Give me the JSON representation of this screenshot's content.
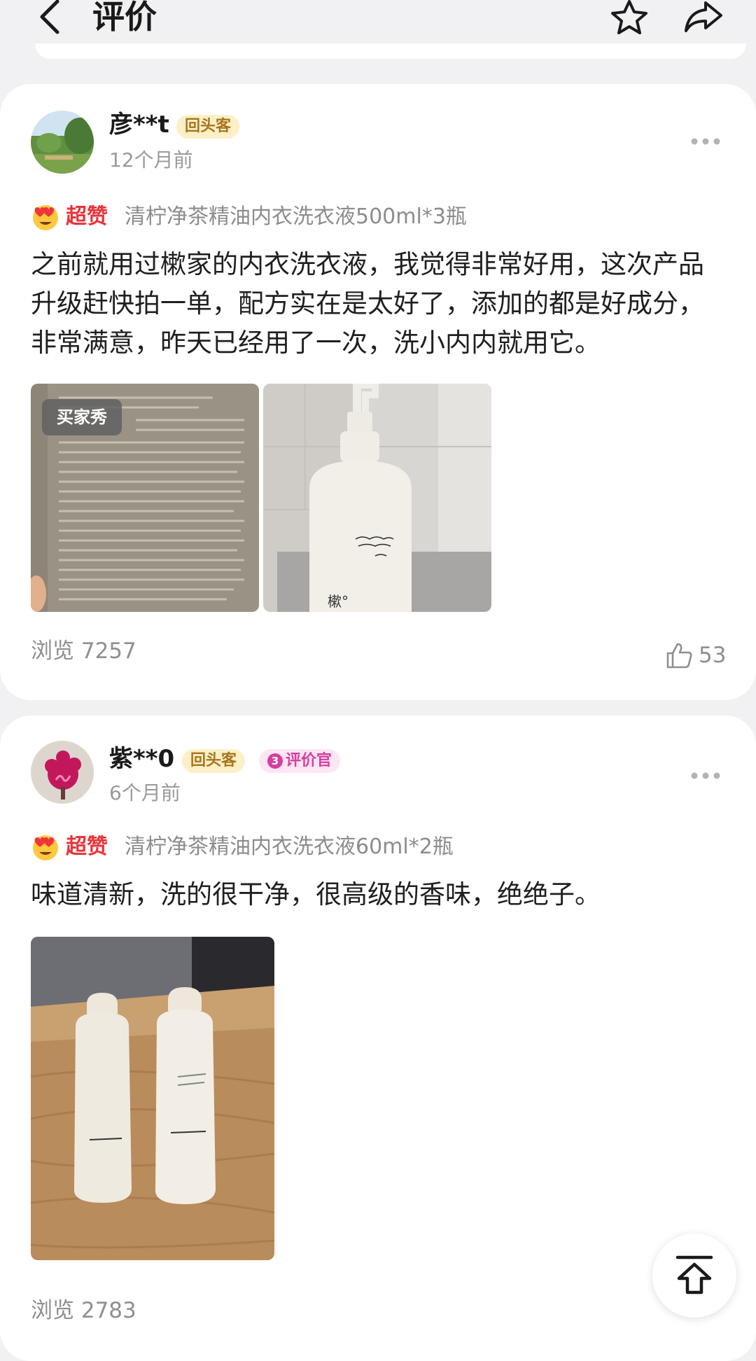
{
  "header": {
    "title": "评价",
    "back_icon": "chevron-left-icon",
    "favorite_icon": "star-outline-icon",
    "share_icon": "share-arrow-icon"
  },
  "reviews": [
    {
      "username": "彦**t",
      "badges": [
        "回头客"
      ],
      "time": "12个月前",
      "rating_label": "超赞",
      "rating_icon": "heart-eyes-emoji-icon",
      "product": "清柠净茶精油内衣洗衣液500ml*3瓶",
      "text": "之前就用过樕家的内衣洗衣液，我觉得非常好用，这次产品升级赶快拍一单，配方实在是太好了，添加的都是好成分，非常满意，昨天已经用了一次，洗小内内就用它。",
      "photo_tag": "买家秀",
      "photo_count": 2,
      "views": "浏览 7257",
      "likes": "53"
    },
    {
      "username": "紫**0",
      "badges": [
        "回头客",
        "评价官"
      ],
      "reviewer_level": "3",
      "time": "6个月前",
      "rating_label": "超赞",
      "rating_icon": "heart-eyes-emoji-icon",
      "product": "清柠净茶精油内衣洗衣液60ml*2瓶",
      "text": "味道清新，洗的很干净，很高级的香味，绝绝子。",
      "photo_count": 1,
      "views": "浏览 2783"
    }
  ],
  "colors": {
    "background": "#f1f1f3",
    "card": "#ffffff",
    "rating_red": "#e8343b",
    "repeat_badge_bg": "#fdf0c8",
    "repeat_badge_text": "#a8751c",
    "reviewer_badge_bg": "#fde6f3",
    "reviewer_badge_text": "#d63fa0",
    "muted_text": "#8f8f8f"
  },
  "floating": {
    "back_to_top_icon": "arrow-up-to-top-icon"
  }
}
